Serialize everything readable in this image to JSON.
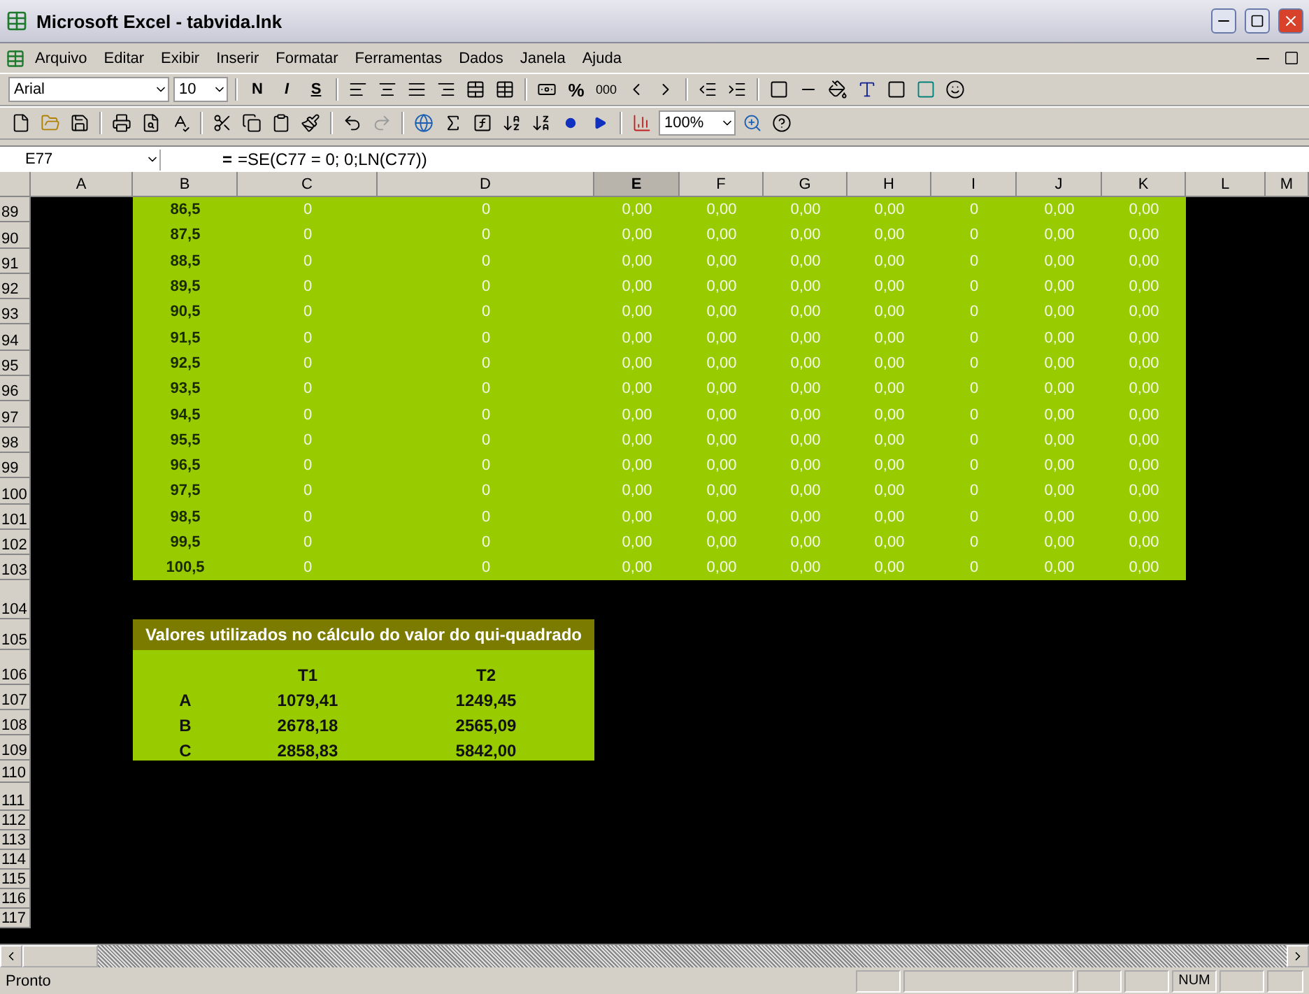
{
  "window": {
    "title": "Microsoft Excel - tabvida.lnk"
  },
  "menu": [
    "Arquivo",
    "Editar",
    "Exibir",
    "Inserir",
    "Formatar",
    "Ferramentas",
    "Dados",
    "Janela",
    "Ajuda"
  ],
  "format_toolbar": {
    "font": "Arial",
    "size": "10",
    "bold": "N",
    "italic": "I",
    "underline": "S",
    "percent": "%",
    "thousands": "000"
  },
  "standard_toolbar": {
    "zoom": "100%"
  },
  "formula_bar": {
    "name_box": "E77",
    "equals": "=",
    "formula": "=SE(C77 = 0; 0;LN(C77))"
  },
  "columns": [
    {
      "label": "A",
      "selected": false
    },
    {
      "label": "B",
      "selected": false
    },
    {
      "label": "C",
      "selected": false
    },
    {
      "label": "D",
      "selected": false
    },
    {
      "label": "E",
      "selected": true
    },
    {
      "label": "F",
      "selected": false
    },
    {
      "label": "G",
      "selected": false
    },
    {
      "label": "H",
      "selected": false
    },
    {
      "label": "I",
      "selected": false
    },
    {
      "label": "J",
      "selected": false
    },
    {
      "label": "K",
      "selected": false
    },
    {
      "label": "L",
      "selected": false
    },
    {
      "label": "M",
      "selected": false
    }
  ],
  "rows": [
    {
      "number": "89",
      "cells": [
        "86,5",
        "0",
        "0",
        "0,00",
        "0,00",
        "0,00",
        "0,00",
        "0",
        "0,00",
        "0,00"
      ]
    },
    {
      "number": "90",
      "cells": [
        "87,5",
        "0",
        "0",
        "0,00",
        "0,00",
        "0,00",
        "0,00",
        "0",
        "0,00",
        "0,00"
      ]
    },
    {
      "number": "91",
      "cells": [
        "88,5",
        "0",
        "0",
        "0,00",
        "0,00",
        "0,00",
        "0,00",
        "0",
        "0,00",
        "0,00"
      ]
    },
    {
      "number": "92",
      "cells": [
        "89,5",
        "0",
        "0",
        "0,00",
        "0,00",
        "0,00",
        "0,00",
        "0",
        "0,00",
        "0,00"
      ]
    },
    {
      "number": "93",
      "cells": [
        "90,5",
        "0",
        "0",
        "0,00",
        "0,00",
        "0,00",
        "0,00",
        "0",
        "0,00",
        "0,00"
      ]
    },
    {
      "number": "94",
      "cells": [
        "91,5",
        "0",
        "0",
        "0,00",
        "0,00",
        "0,00",
        "0,00",
        "0",
        "0,00",
        "0,00"
      ]
    },
    {
      "number": "95",
      "cells": [
        "92,5",
        "0",
        "0",
        "0,00",
        "0,00",
        "0,00",
        "0,00",
        "0",
        "0,00",
        "0,00"
      ]
    },
    {
      "number": "96",
      "cells": [
        "93,5",
        "0",
        "0",
        "0,00",
        "0,00",
        "0,00",
        "0,00",
        "0",
        "0,00",
        "0,00"
      ]
    },
    {
      "number": "97",
      "cells": [
        "94,5",
        "0",
        "0",
        "0,00",
        "0,00",
        "0,00",
        "0,00",
        "0",
        "0,00",
        "0,00"
      ]
    },
    {
      "number": "98",
      "cells": [
        "95,5",
        "0",
        "0",
        "0,00",
        "0,00",
        "0,00",
        "0,00",
        "0",
        "0,00",
        "0,00"
      ]
    },
    {
      "number": "99",
      "cells": [
        "96,5",
        "0",
        "0",
        "0,00",
        "0,00",
        "0,00",
        "0,00",
        "0",
        "0,00",
        "0,00"
      ]
    },
    {
      "number": "100",
      "cells": [
        "97,5",
        "0",
        "0",
        "0,00",
        "0,00",
        "0,00",
        "0,00",
        "0",
        "0,00",
        "0,00"
      ]
    },
    {
      "number": "101",
      "cells": [
        "98,5",
        "0",
        "0",
        "0,00",
        "0,00",
        "0,00",
        "0,00",
        "0",
        "0,00",
        "0,00"
      ]
    },
    {
      "number": "102",
      "cells": [
        "99,5",
        "0",
        "0",
        "0,00",
        "0,00",
        "0,00",
        "0,00",
        "0",
        "0,00",
        "0,00"
      ]
    },
    {
      "number": "103",
      "cells": [
        "100,5",
        "0",
        "0",
        "0,00",
        "0,00",
        "0,00",
        "0,00",
        "0",
        "0,00",
        "0,00"
      ]
    }
  ],
  "lower_rows": [
    "104",
    "105",
    "106",
    "107",
    "108",
    "109",
    "110",
    "111",
    "112",
    "113",
    "114",
    "115",
    "116",
    "117"
  ],
  "summary": {
    "title": "Valores utilizados no cálculo do valor do qui-quadrado",
    "headers": [
      "T1",
      "T2"
    ],
    "rows": [
      {
        "label": "A",
        "values": [
          "1079,41",
          "1249,45"
        ]
      },
      {
        "label": "B",
        "values": [
          "2678,18",
          "2565,09"
        ]
      },
      {
        "label": "C",
        "values": [
          "2858,83",
          "5842,00"
        ]
      }
    ]
  },
  "status_bar": {
    "message": "Pronto",
    "num": "NUM"
  }
}
